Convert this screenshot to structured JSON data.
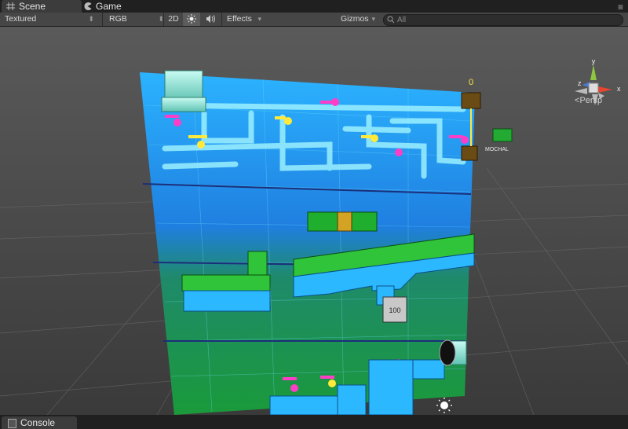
{
  "tabs": [
    {
      "label": "Scene",
      "icon": "grid-icon",
      "active": true
    },
    {
      "label": "Game",
      "icon": "pacman-icon",
      "active": false
    }
  ],
  "toolbar": {
    "render_mode": "Textured",
    "color_mode": "RGB",
    "mode_2d": "2D",
    "lighting_icon": "sun-icon",
    "audio_icon": "speaker-icon",
    "effects_label": "Effects",
    "gizmos_label": "Gizmos",
    "search_placeholder": "All"
  },
  "scene": {
    "counter_label": "100",
    "gizmo_axes": [
      "y",
      "x",
      "z"
    ],
    "projection_label": "Persp",
    "top_marker": "0",
    "side_tag": "MOCHAL"
  },
  "bottom": {
    "console_label": "Console"
  },
  "colors": {
    "accent_y": "#8ec63f",
    "accent_x": "#e8452f",
    "accent_z": "#4b7bd3",
    "viewport_bg": "#474747"
  }
}
